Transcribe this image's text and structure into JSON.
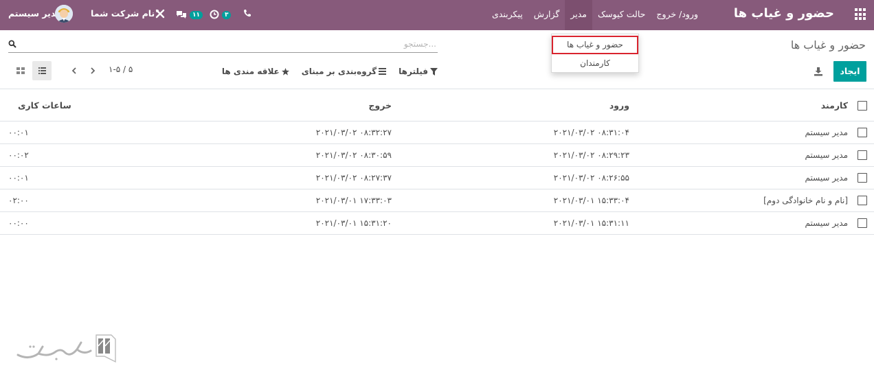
{
  "navbar": {
    "brand": "حضور و غیاب ها",
    "menu": [
      "ورود/ خروج",
      "حالت کیوسک",
      "مدیر",
      "گزارش",
      "پیکربندی"
    ],
    "company": "نام شرکت شما",
    "user": "مدیر سیستم",
    "messages_badge": "۱۱",
    "activities_badge": "۳"
  },
  "dropdown": {
    "items": [
      "حضور و غیاب ها",
      "کارمندان"
    ]
  },
  "control_panel": {
    "title": "حضور و غیاب ها",
    "search_placeholder": "جستجو...",
    "create_label": "ایجاد",
    "filters_label": "فیلترها",
    "groupby_label": "گروه‌بندی بر مبنای",
    "favorites_label": "علاقه مندی ها",
    "pager": "۱-۵ / ۵"
  },
  "table": {
    "headers": {
      "employee": "کارمند",
      "check_in": "ورود",
      "check_out": "خروج",
      "worked_hours": "ساعات کاری"
    },
    "rows": [
      {
        "employee": "مدیر سیستم",
        "check_in": "۲۰۲۱/۰۳/۰۲ ۰۸:۳۱:۰۴",
        "check_out": "۲۰۲۱/۰۳/۰۲ ۰۸:۳۲:۲۷",
        "worked_hours": "۰۰:۰۱"
      },
      {
        "employee": "مدیر سیستم",
        "check_in": "۲۰۲۱/۰۳/۰۲ ۰۸:۲۹:۲۳",
        "check_out": "۲۰۲۱/۰۳/۰۲ ۰۸:۳۰:۵۹",
        "worked_hours": "۰۰:۰۲"
      },
      {
        "employee": "مدیر سیستم",
        "check_in": "۲۰۲۱/۰۳/۰۲ ۰۸:۲۶:۵۵",
        "check_out": "۲۰۲۱/۰۳/۰۲ ۰۸:۲۷:۳۷",
        "worked_hours": "۰۰:۰۱"
      },
      {
        "employee": "[نام و نام خانوادگی دوم]",
        "check_in": "۲۰۲۱/۰۳/۰۱ ۱۵:۳۳:۰۴",
        "check_out": "۲۰۲۱/۰۳/۰۱ ۱۷:۳۳:۰۳",
        "worked_hours": "۰۲:۰۰"
      },
      {
        "employee": "مدیر سیستم",
        "check_in": "۲۰۲۱/۰۳/۰۱ ۱۵:۳۱:۱۱",
        "check_out": "۲۰۲۱/۰۳/۰۱ ۱۵:۳۱:۲۰",
        "worked_hours": "۰۰:۰۰"
      }
    ]
  },
  "watermark": "تسهیل گستر",
  "colors": {
    "navbar": "#875a7b",
    "primary_button": "#00a09d",
    "highlight_border": "#d9232e"
  }
}
